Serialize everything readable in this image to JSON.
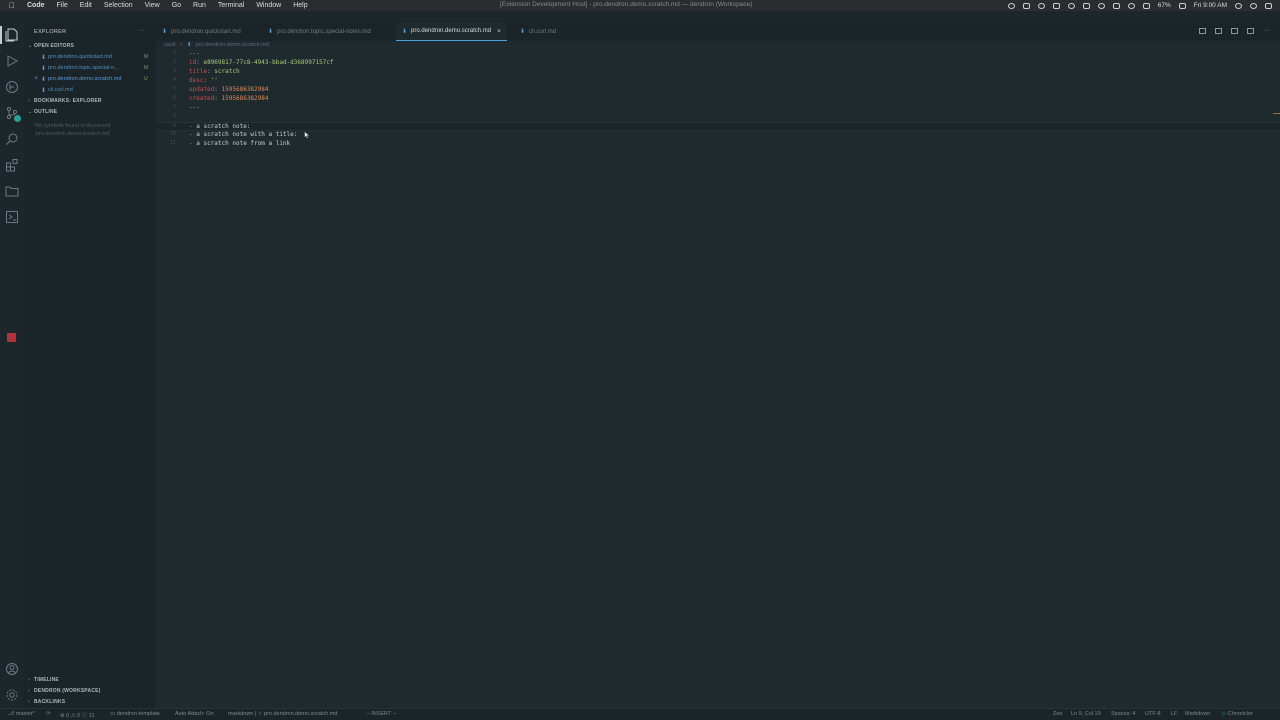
{
  "menubar": {
    "items": [
      "Code",
      "File",
      "Edit",
      "Selection",
      "View",
      "Go",
      "Run",
      "Terminal",
      "Window",
      "Help"
    ],
    "window_title": "[Extension Development Host] - pro.dendron.demo.scratch.md — dendron (Workspace)",
    "battery": "67%",
    "clock": "Fri 9:00 AM"
  },
  "sidebar": {
    "title": "EXPLORER",
    "open_editors_label": "OPEN EDITORS",
    "open_editors": [
      {
        "name": "pro.dendron.quickstart.md",
        "status": "M"
      },
      {
        "name": "pro.dendron.topic.special-n...",
        "status": "M"
      },
      {
        "name": "pro.dendron.demo.scratch.md",
        "status": "U"
      },
      {
        "name": "cli.curl.md",
        "status": ""
      }
    ],
    "bookmarks_label": "BOOKMARKS: EXPLORER",
    "outline_label": "OUTLINE",
    "outline_empty": "No symbols found in document 'pro.dendron.demo.scratch.md'",
    "timeline_label": "TIMELINE",
    "dendron_label": "DENDRON (WORKSPACE)",
    "backlinks_label": "BACKLINKS"
  },
  "tabs": [
    {
      "label": "pro.dendron.quickstart.md"
    },
    {
      "label": "pro.dendron.topic.special-notes.md"
    },
    {
      "label": "pro.dendron.demo.scratch.md",
      "close": "×"
    },
    {
      "label": "cli.curl.md"
    }
  ],
  "breadcrumb": {
    "root": "vault",
    "sep": ">",
    "file": "pro.dendron.demo.scratch.md"
  },
  "editor": {
    "lines": [
      {
        "num": "1",
        "type": "fence",
        "text": "---"
      },
      {
        "num": "2",
        "type": "kv",
        "key": "id",
        "value": "e8969817-77c8-4943-bbad-d368997157cf",
        "vtype": "s"
      },
      {
        "num": "3",
        "type": "kv",
        "key": "title",
        "value": "scratch",
        "vtype": "s"
      },
      {
        "num": "4",
        "type": "kv",
        "key": "desc",
        "value": "''",
        "vtype": "s"
      },
      {
        "num": "5",
        "type": "kv",
        "key": "updated",
        "value": "1595686382984",
        "vtype": "n"
      },
      {
        "num": "6",
        "type": "kv",
        "key": "created",
        "value": "1595686382984",
        "vtype": "n"
      },
      {
        "num": "7",
        "type": "fence",
        "text": "---"
      },
      {
        "num": "8",
        "type": "blank",
        "text": ""
      },
      {
        "num": "9",
        "type": "bullet",
        "text": "a scratch note:",
        "current": true
      },
      {
        "num": "10",
        "type": "bullet",
        "text": "a scratch note with a title:"
      },
      {
        "num": "11",
        "type": "bullet",
        "text": "a scratch note from a link"
      }
    ]
  },
  "statusbar": {
    "branch": "master*",
    "problems": "⊗ 0 ⚠ 0 ⓘ 11",
    "folder": "dendron-template",
    "auto_attach": "Auto Attach: On",
    "language_crumb": "markdown | ✓ pro.dendron.demo.scratch.md",
    "mode": "-- INSERT --",
    "zen": "Zen",
    "position": "Ln 9, Col 19",
    "spaces": "Spaces: 4",
    "encoding": "UTF-8",
    "eol": "LF",
    "language": "Markdown",
    "chronicler": "Chronicler"
  },
  "icons": [
    "apple-icon",
    "files-icon",
    "run-debug-icon",
    "git-icon",
    "source-control-icon",
    "search-icon",
    "extensions-icon",
    "folder-icon",
    "remote-icon",
    "stop-icon",
    "account-icon",
    "gear-icon",
    "markdown-file-icon",
    "close-icon",
    "split-editor-icon",
    "chevron-icon"
  ],
  "colors": {
    "accent": "#4fa3d9",
    "yaml_key": "#cb4b4b",
    "yaml_string": "#a9c77a",
    "yaml_number": "#dc8a5b",
    "badge": "#2aa198",
    "stop": "#b3333d"
  }
}
